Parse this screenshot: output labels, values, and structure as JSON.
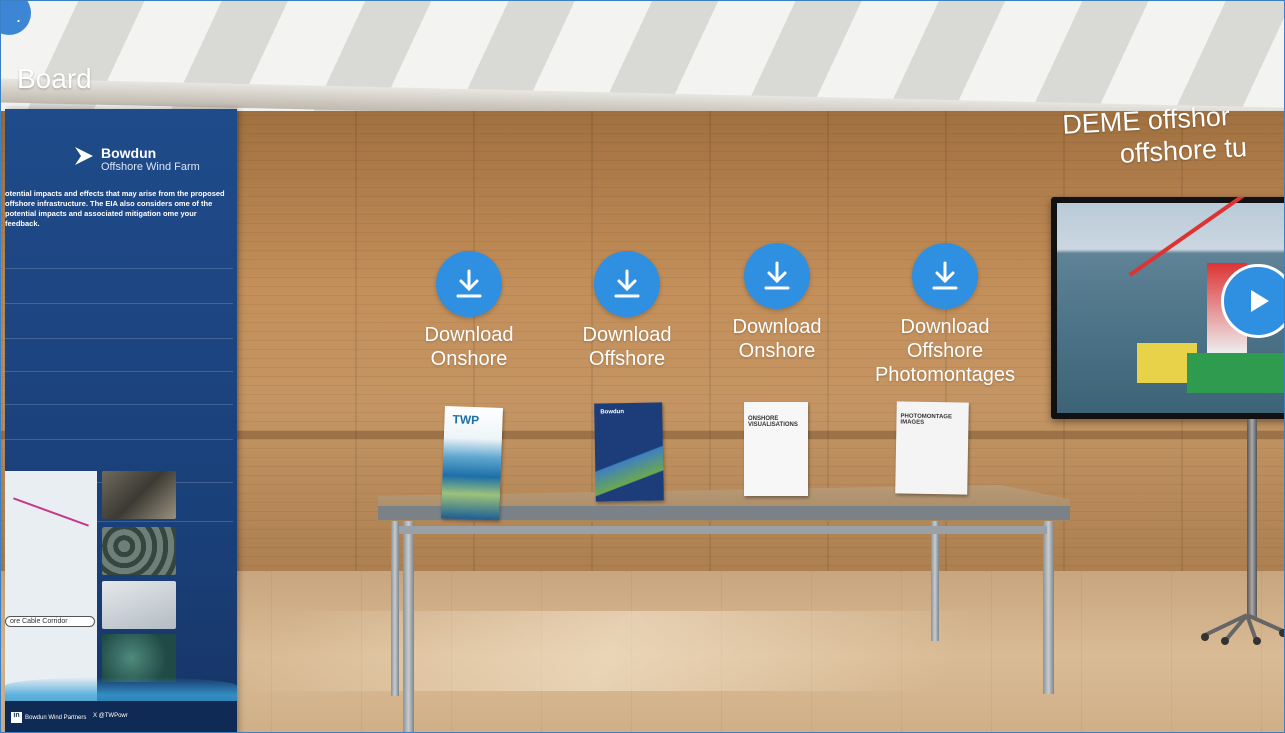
{
  "scene": {
    "board_title": "Board",
    "deme_title_line1": "DEME offshor",
    "deme_title_line2": "offshore tu"
  },
  "banner": {
    "logo_name": "Bowdun",
    "logo_sub": "Offshore Wind Farm",
    "lead_text": "otential impacts and effects that may arise from the proposed offshore infrastructure. The EIA also considers ome of the potential impacts and associated mitigation ome your feedback.",
    "map_label": "ore Cable Corridor",
    "footer_linkedin": "in",
    "footer_linkedin_text": "Bowdun Wind Partners",
    "footer_x": "X @TWPowr"
  },
  "downloads": [
    {
      "line1": "Download",
      "line2": "Onshore",
      "line3": ""
    },
    {
      "line1": "Download",
      "line2": "Offshore",
      "line3": ""
    },
    {
      "line1": "Download",
      "line2": "Onshore",
      "line3": ""
    },
    {
      "line1": "Download",
      "line2": "Offshore",
      "line3": "Photomontages"
    }
  ],
  "brochures": [
    {
      "title": "TWP"
    },
    {
      "title": "Bowdun"
    },
    {
      "title": "ONSHORE VISUALISATIONS"
    },
    {
      "title": "PHOTOMONTAGE IMAGES"
    }
  ],
  "colors": {
    "accent_blue": "#2f8fe0",
    "banner_blue": "#1f4b8a"
  },
  "icons": {
    "download": "download-arrow-icon",
    "play": "play-icon"
  }
}
